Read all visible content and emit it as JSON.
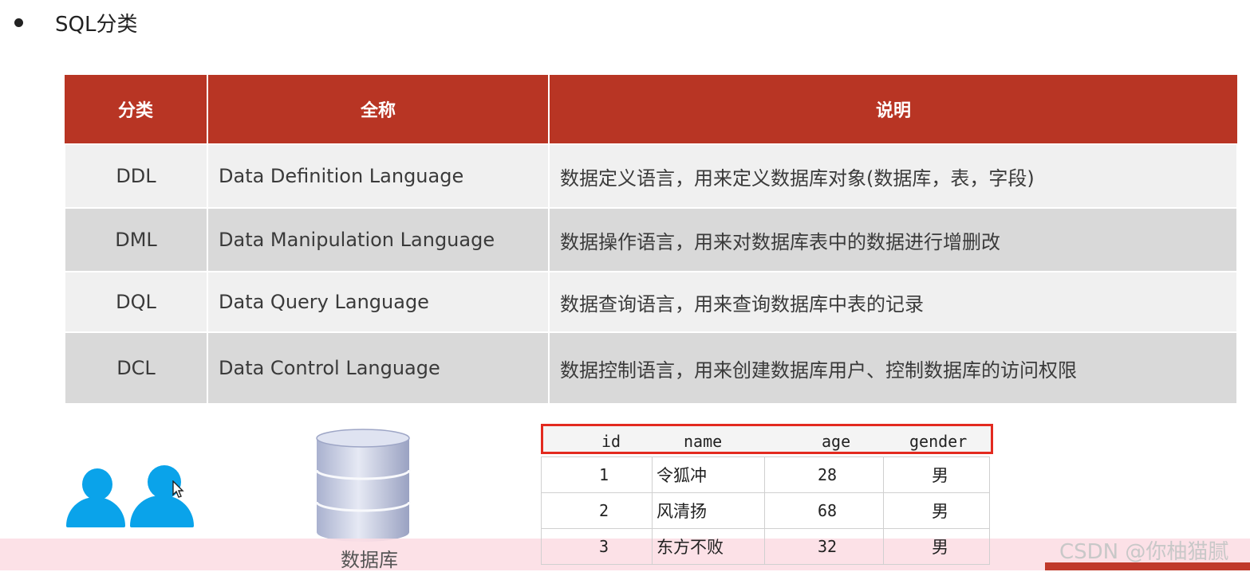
{
  "heading": {
    "text": "SQL分类"
  },
  "table": {
    "headers": [
      "分类",
      "全称",
      "说明"
    ],
    "rows": [
      {
        "abbr": "DDL",
        "full": "Data Definition Language",
        "desc": "数据定义语言，用来定义数据库对象(数据库，表，字段)"
      },
      {
        "abbr": "DML",
        "full": "Data Manipulation Language",
        "desc": "数据操作语言，用来对数据库表中的数据进行增删改"
      },
      {
        "abbr": "DQL",
        "full": "Data Query Language",
        "desc": "数据查询语言，用来查询数据库中表的记录"
      },
      {
        "abbr": "DCL",
        "full": "Data Control Language",
        "desc": "数据控制语言，用来创建数据库用户、控制数据库的访问权限"
      }
    ]
  },
  "database": {
    "label": "数据库"
  },
  "sample_table": {
    "columns": [
      "id",
      "name",
      "age",
      "gender"
    ],
    "rows": [
      {
        "id": "1",
        "name": "令狐冲",
        "age": "28",
        "gender": "男"
      },
      {
        "id": "2",
        "name": "风清扬",
        "age": "68",
        "gender": "男"
      },
      {
        "id": "3",
        "name": "东方不败",
        "age": "32",
        "gender": "男"
      }
    ]
  },
  "watermark": {
    "text": "CSDN @你柚猫腻"
  },
  "colors": {
    "header_red": "#b83524",
    "user_blue": "#0aa3ea",
    "highlight_red": "#e32a1f"
  },
  "icons": [
    "users-icon",
    "database-icon",
    "mouse-cursor-icon"
  ]
}
